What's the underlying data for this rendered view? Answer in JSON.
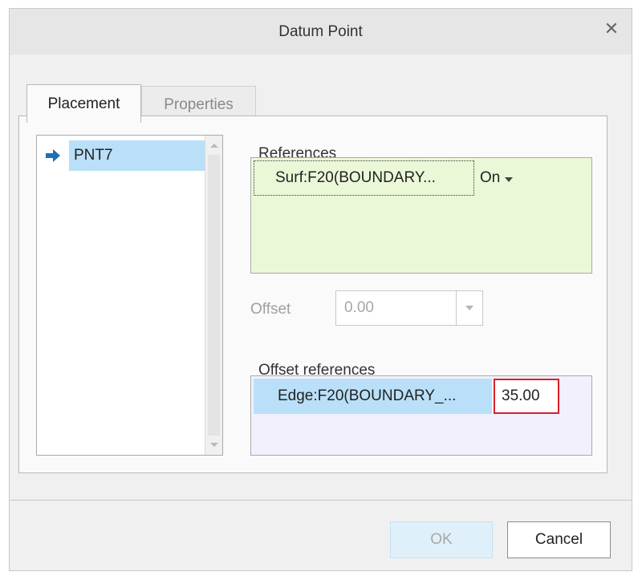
{
  "window": {
    "title": "Datum Point"
  },
  "tabs": [
    {
      "label": "Placement",
      "active": true
    },
    {
      "label": "Properties",
      "active": false
    }
  ],
  "tree": {
    "items": [
      {
        "label": "PNT7",
        "selected": true,
        "icon": "arrow-right-icon"
      }
    ]
  },
  "references": {
    "label": "References",
    "items": [
      {
        "ref": "Surf:F20(BOUNDARY...",
        "type": "On"
      }
    ]
  },
  "offset": {
    "label": "Offset",
    "value": "0.00",
    "enabled": false
  },
  "offset_references": {
    "label": "Offset references",
    "items": [
      {
        "ref": "Edge:F20(BOUNDARY_...",
        "value": "35.00"
      }
    ]
  },
  "buttons": {
    "ok_label": "OK",
    "cancel_label": "Cancel"
  },
  "colors": {
    "selection": "#b9e0f8",
    "references_bg": "#ebf8d8",
    "offset_references_bg": "#f2f0fd",
    "highlight_border": "#d8202a",
    "arrow": "#1e6fb4"
  }
}
